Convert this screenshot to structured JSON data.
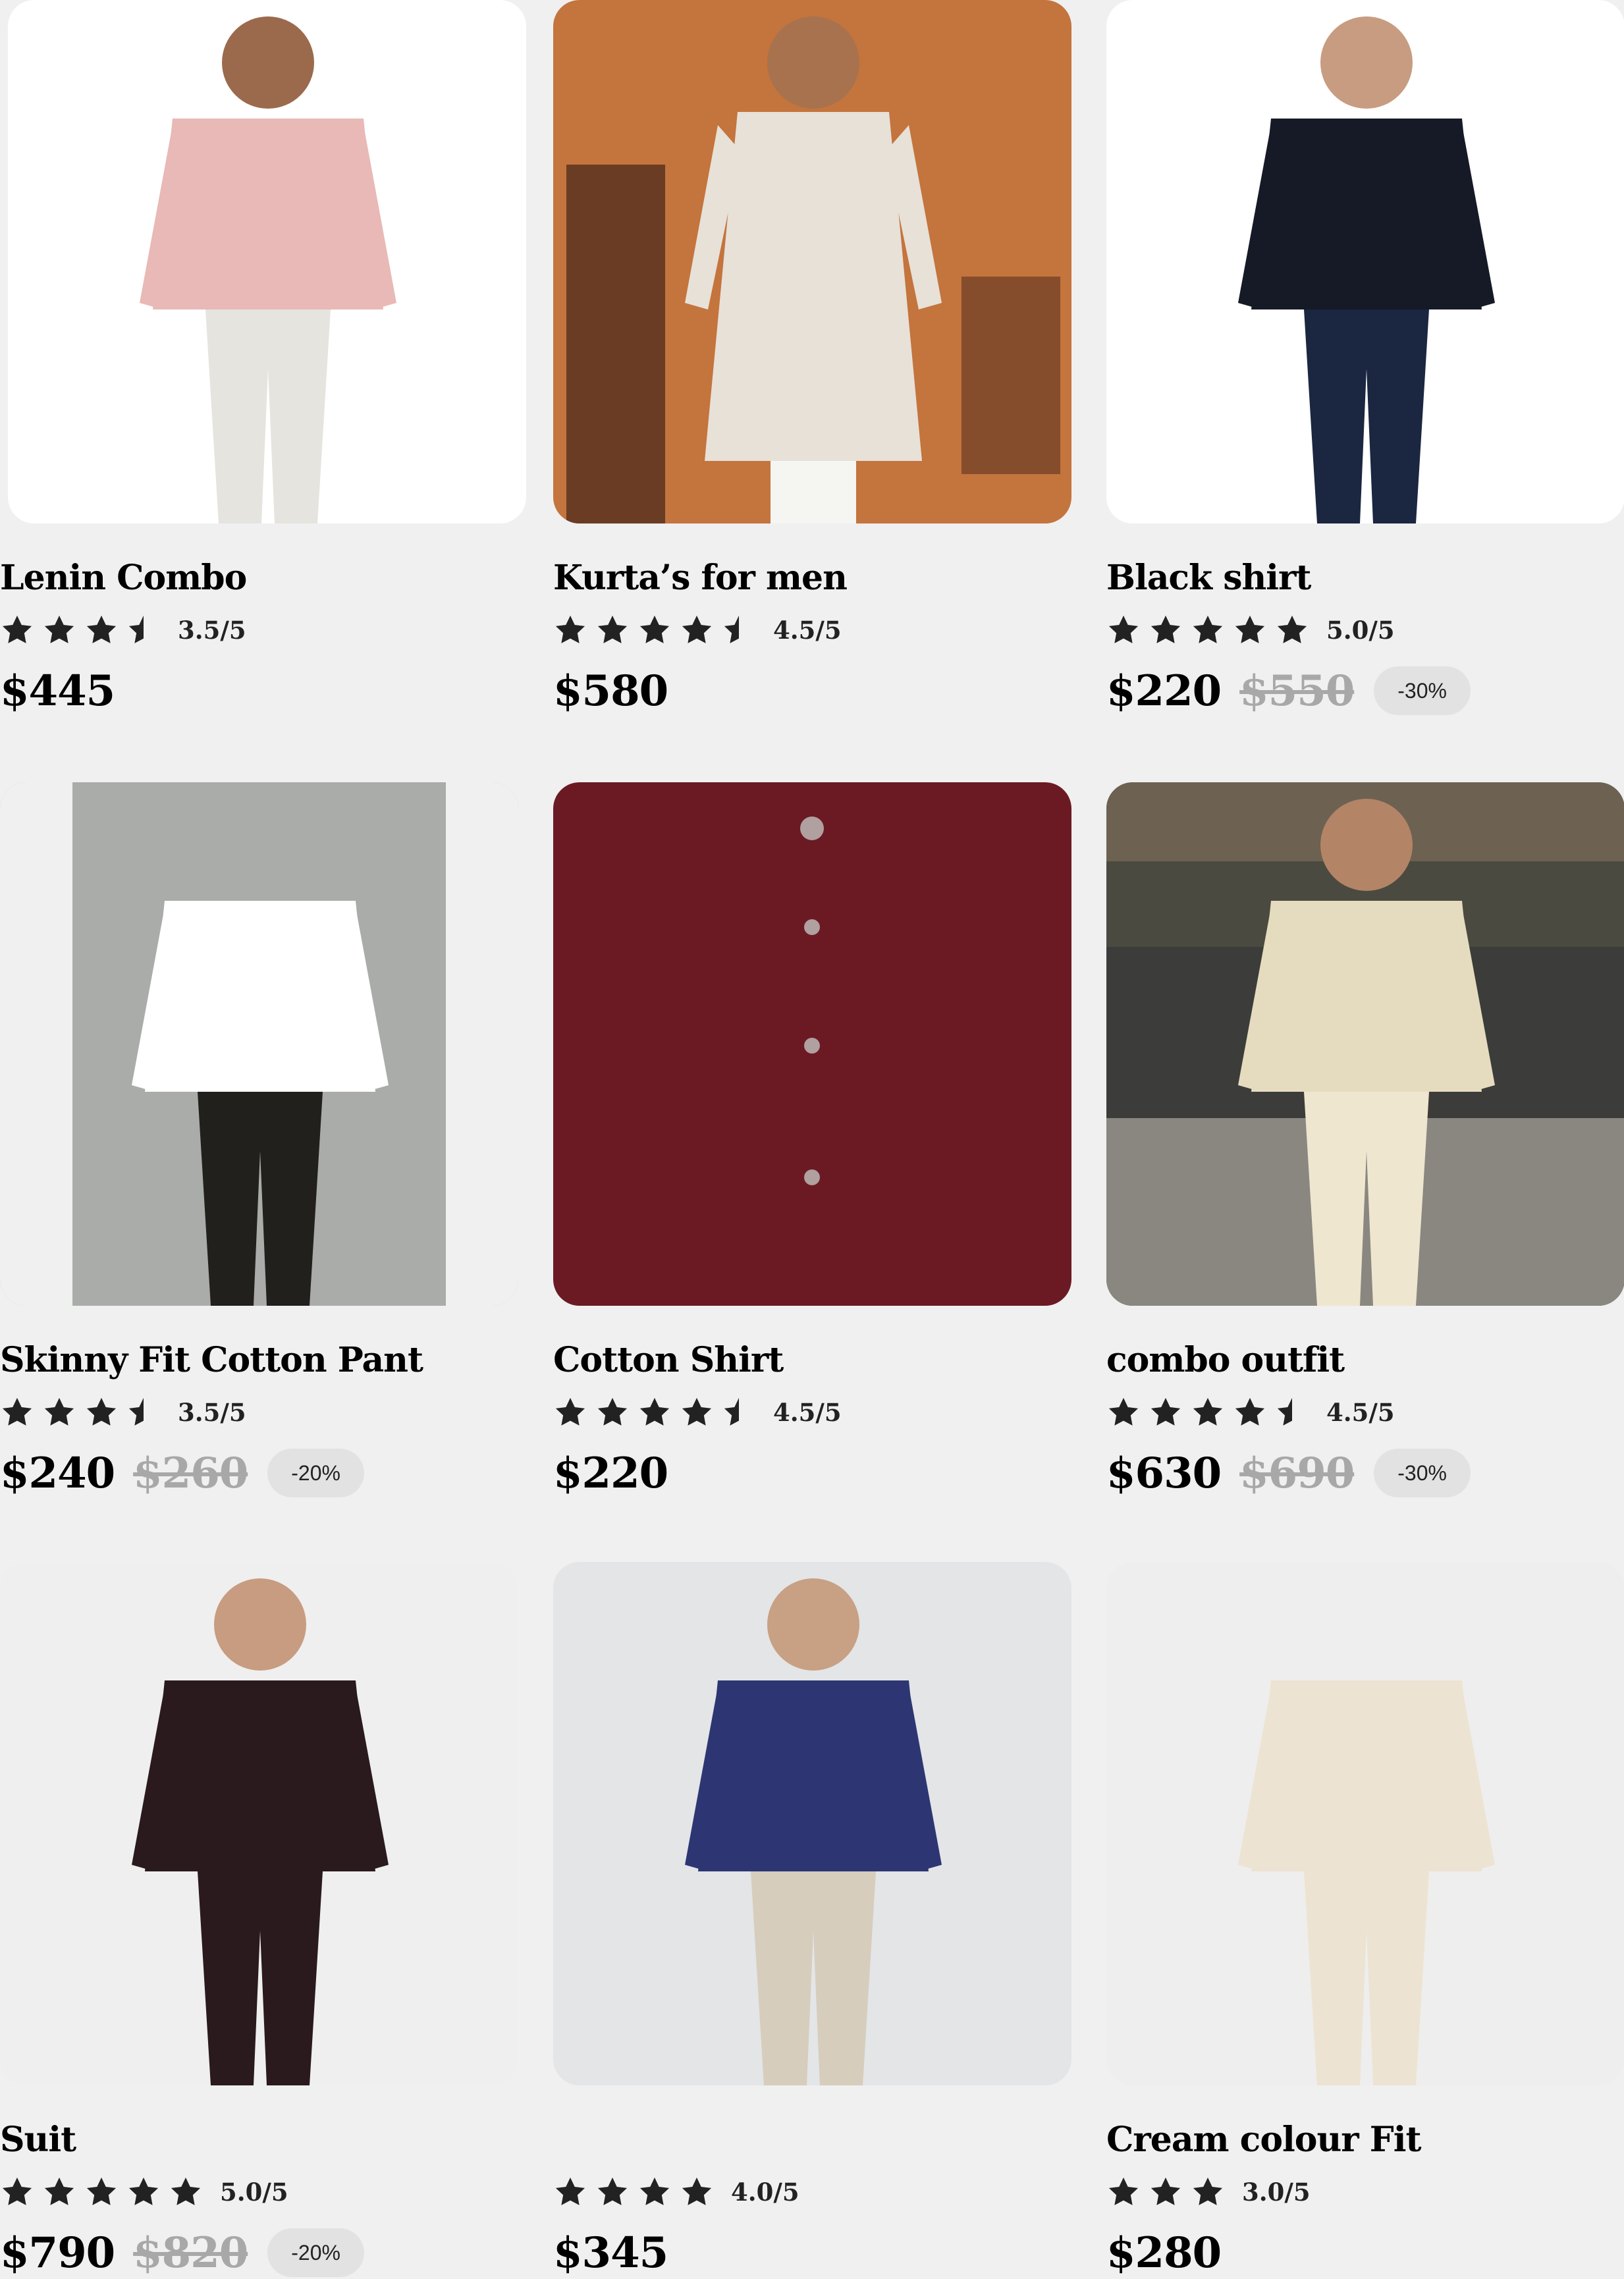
{
  "products": [
    {
      "name": "Lenin Combo",
      "stars": [
        1,
        1,
        1,
        0.5
      ],
      "rating": "3.5/5",
      "price": "$445",
      "old_price": "",
      "discount": "",
      "image_colors": {
        "bg": "#ffffff",
        "top": "#e8b9b6",
        "bottom": "#e6e4df",
        "skin": "#9b6a4c"
      }
    },
    {
      "name": "Kurta’s for men",
      "stars": [
        1,
        1,
        1,
        1,
        0.5
      ],
      "rating": "4.5/5",
      "price": "$580",
      "old_price": "",
      "discount": "",
      "image_colors": {
        "bg": "#c4743d",
        "top": "#e7e1d8",
        "bottom": "#f5f5f2",
        "skin": "#a8724e"
      }
    },
    {
      "name": "Black  shirt",
      "stars": [
        1,
        1,
        1,
        1,
        1
      ],
      "rating": "5.0/5",
      "price": "$220",
      "old_price": "$550",
      "discount": "-30%",
      "image_colors": {
        "bg": "#ffffff",
        "top": "#151a26",
        "bottom": "#1b2640",
        "skin": "#c89c81"
      }
    },
    {
      "name": "Skinny Fit Cotton Pant",
      "stars": [
        1,
        1,
        1,
        0.5
      ],
      "rating": "3.5/5",
      "price": "$240",
      "old_price": "$260",
      "discount": "-20%",
      "image_colors": {
        "bg": "#a9aca8",
        "top": "#ffffff",
        "bottom": "#22201d",
        "skin": "#c89c81"
      }
    },
    {
      "name": "Cotton  Shirt",
      "stars": [
        1,
        1,
        1,
        1,
        0.5
      ],
      "rating": "4.5/5",
      "price": "$220",
      "old_price": "",
      "discount": "",
      "image_colors": {
        "bg": "#ffffff",
        "top": "#6b1a23",
        "bottom": "#6b1a23",
        "skin": "#d9b59f"
      }
    },
    {
      "name": "combo outfit",
      "stars": [
        1,
        1,
        1,
        1,
        0.5
      ],
      "rating": "4.5/5",
      "price": "$630",
      "old_price": "$690",
      "discount": "-30%",
      "image_colors": {
        "bg": "#4a4a40",
        "top": "#e5dcc0",
        "bottom": "#eee6cf",
        "skin": "#b38466"
      }
    },
    {
      "name": "Suit",
      "stars": [
        1,
        1,
        1,
        1,
        1
      ],
      "rating": "5.0/5",
      "price": "$790",
      "old_price": "$820",
      "discount": "-20%",
      "image_colors": {
        "bg": "#efefef",
        "top": "#2a1a1d",
        "bottom": "#2a1a1d",
        "skin": "#c89c81"
      }
    },
    {
      "name": "",
      "stars": [
        1,
        1,
        1,
        1
      ],
      "rating": "4.0/5",
      "price": "$345",
      "old_price": "",
      "discount": "",
      "image_colors": {
        "bg": "#e3e5e7",
        "top": "#2d3672",
        "bottom": "#d6cdbc",
        "skin": "#c8a083"
      }
    },
    {
      "name": "Cream colour Fit",
      "stars": [
        1,
        1,
        1
      ],
      "rating": "3.0/5",
      "price": "$280",
      "old_price": "",
      "discount": "",
      "image_colors": {
        "bg": "#eeeeee",
        "top": "#ede3d3",
        "bottom": "#ede3d3",
        "skin": "#c89c81"
      }
    }
  ]
}
